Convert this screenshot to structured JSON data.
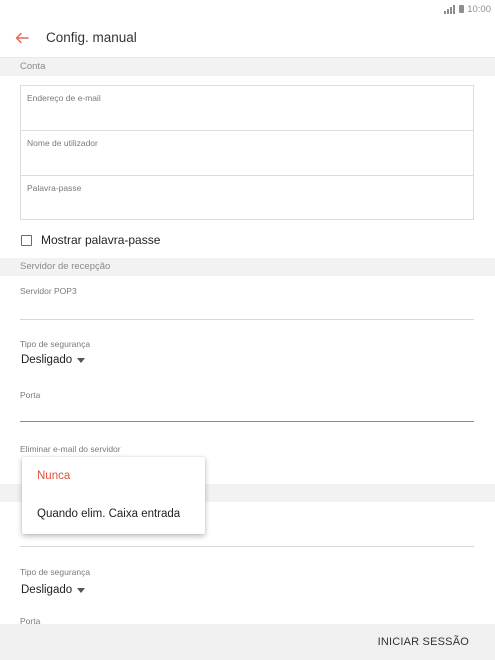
{
  "status_bar": {
    "time": "10:00",
    "signal_icon": "signal-icon",
    "battery_icon": "battery-icon"
  },
  "app_bar": {
    "title": "Config. manual",
    "back_icon": "arrow-left-icon"
  },
  "account_section": {
    "title": "Conta",
    "fields": [
      {
        "label": "Endereço de e-mail",
        "value": ""
      },
      {
        "label": "Nome de utilizador",
        "value": ""
      },
      {
        "label": "Palavra-passe",
        "value": ""
      }
    ],
    "show_password": {
      "label": "Mostrar palavra-passe",
      "checked": false
    }
  },
  "incoming_section": {
    "title": "Servidor de recepção",
    "server_label": "Servidor POP3",
    "server_value": "",
    "security_label": "Tipo de segurança",
    "security_value": "Desligado",
    "port_label": "Porta",
    "port_value": "",
    "delete_label": "Eliminar e-mail do servidor"
  },
  "delete_popup": {
    "options": [
      {
        "label": "Nunca",
        "selected": true
      },
      {
        "label": "Quando elim. Caixa entrada",
        "selected": false
      }
    ]
  },
  "outgoing_section": {
    "security_label": "Tipo de segurança",
    "security_value": "Desligado",
    "port_label": "Porta"
  },
  "bottom_bar": {
    "signin_label": "INICIAR SESSÃO"
  },
  "colors": {
    "accent": "#e46a52",
    "section_bg": "#f2f2f2",
    "bottom_bg": "#f0f0f0"
  }
}
